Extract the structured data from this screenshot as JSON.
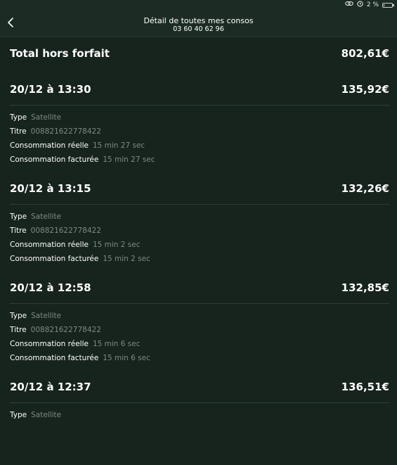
{
  "status": {
    "battery_text": "2 %",
    "battery_level_percent": 2,
    "icons": [
      "link-icon",
      "alarm-icon",
      "battery-icon"
    ]
  },
  "header": {
    "title": "Détail de toutes mes consos",
    "subtitle": "03 60 40 62 96",
    "back_icon": "chevron-left-icon"
  },
  "summary": {
    "label": "Total hors forfait",
    "value": "802,61€"
  },
  "labels": {
    "type": "Type",
    "title": "Titre",
    "real": "Consommation réelle",
    "billed": "Consommation facturée"
  },
  "calls": [
    {
      "date": "20/12 à 13:30",
      "amount": "135,92€",
      "type": "Satellite",
      "title": "008821622778422",
      "real": "15 min 27 sec",
      "billed": "15 min 27 sec"
    },
    {
      "date": "20/12 à 13:15",
      "amount": "132,26€",
      "type": "Satellite",
      "title": "008821622778422",
      "real": "15 min 2 sec",
      "billed": "15 min 2 sec"
    },
    {
      "date": "20/12 à 12:58",
      "amount": "132,85€",
      "type": "Satellite",
      "title": "008821622778422",
      "real": "15 min 6 sec",
      "billed": "15 min 6 sec"
    },
    {
      "date": "20/12 à 12:37",
      "amount": "136,51€",
      "type": "Satellite"
    }
  ],
  "colors": {
    "background": "#17241e",
    "header": "#1c2c25",
    "muted_text": "#7d8a84",
    "text": "#ffffff"
  }
}
